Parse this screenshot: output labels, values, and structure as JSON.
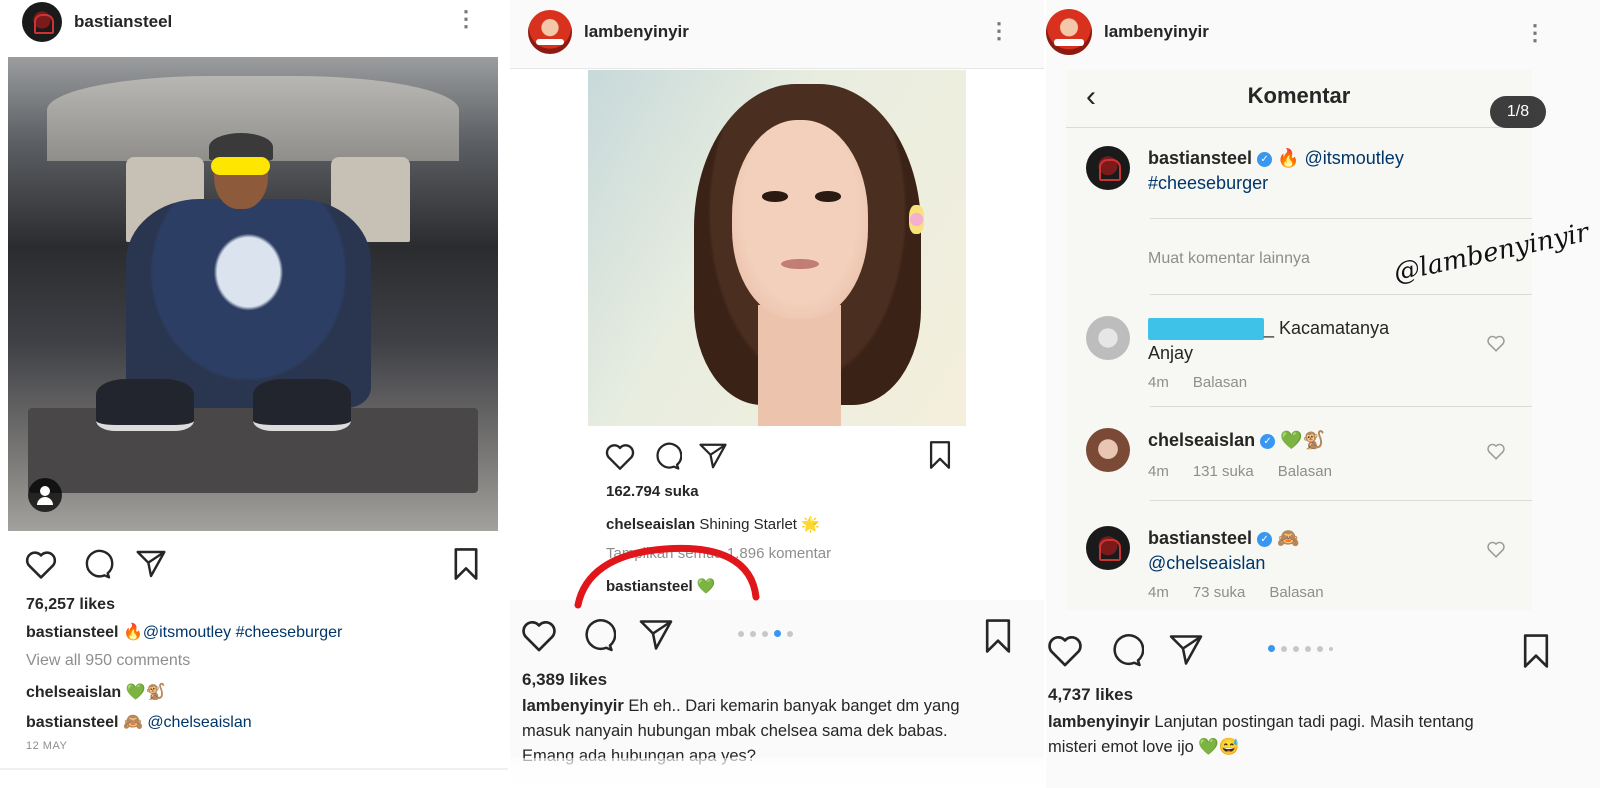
{
  "panel1": {
    "username": "bastiansteel",
    "likes": "76,257 likes",
    "caption_user": "bastiansteel",
    "caption_emoji": "🔥",
    "caption_text": "@itsmoutley #cheeseburger",
    "view_comments": "View all 950 comments",
    "comments": [
      {
        "user": "chelseaislan",
        "text": "💚🐒"
      },
      {
        "user": "bastiansteel",
        "emoji": "🙈",
        "text": "@chelseaislan"
      }
    ],
    "date": "12 MAY",
    "icons": [
      "heart-icon",
      "comment-icon",
      "share-icon",
      "bookmark-icon",
      "more-icon",
      "user-tag-icon"
    ]
  },
  "panel2": {
    "username": "lambenyinyir",
    "likes_inner": "162.794 suka",
    "inner_caption_user": "chelseaislan",
    "inner_caption_text": "Shining Starlet 🌟",
    "inner_view_all": "Tampilkan semua 1.896 komentar",
    "inner_comment_user": "bastiansteel",
    "inner_comment_text": "💚",
    "likes": "6,389 likes",
    "caption_user": "lambenyinyir",
    "caption_lines": [
      "Eh eh.. Dari kemarin banyak banget dm yang",
      "masuk nanyain hubungan mbak chelsea sama dek babas.",
      "Emang ada hubungan apa yes?"
    ],
    "pager_active": 4,
    "pager_count": 5,
    "highlight_color": "#e0161b"
  },
  "panel3": {
    "username": "lambenyinyir",
    "komentar_title": "Komentar",
    "counter": "1/8",
    "watermark": "@lambenyinyir",
    "load_more": "Muat komentar lainnya",
    "main_comment": {
      "user": "bastiansteel",
      "line1_emoji": "🔥",
      "line1": "@itsmoutley",
      "line2": "#cheeseburger"
    },
    "comments": [
      {
        "user_hidden": true,
        "suffix": "_ Kacamatanya",
        "line2": "Anjay",
        "time": "4m",
        "reply": "Balasan"
      },
      {
        "user": "chelseaislan",
        "text": "💚🐒",
        "time": "4m",
        "likes": "131 suka",
        "reply": "Balasan"
      },
      {
        "user": "bastiansteel",
        "text": "🙈",
        "line2": "@chelseaislan",
        "time": "4m",
        "likes": "73 suka",
        "reply": "Balasan"
      }
    ],
    "likes": "4,737 likes",
    "caption_user": "lambenyinyir",
    "caption_lines": [
      "Lanjutan postingan tadi pagi. Masih tentang",
      "misteri emot love ijo 💚😅"
    ],
    "pager_active": 1,
    "pager_count": 6
  },
  "colors": {
    "link": "#003569",
    "muted": "#8e8e8e",
    "accent": "#3897f0",
    "text": "#262626"
  }
}
